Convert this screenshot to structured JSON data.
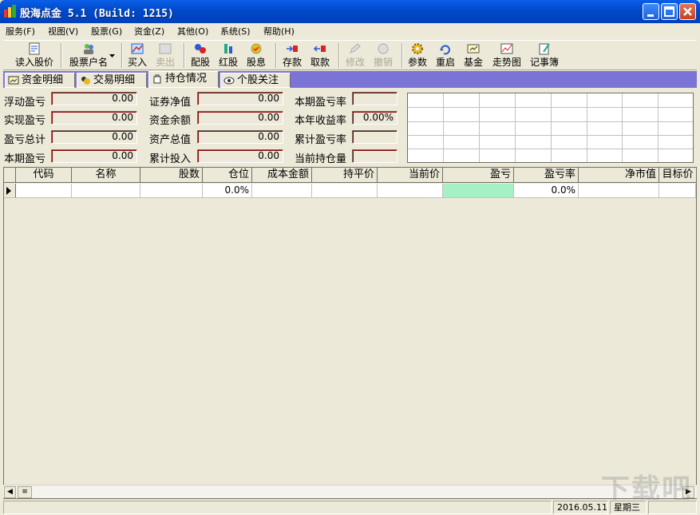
{
  "window": {
    "title": "股海点金 5.1 (Build: 1215)"
  },
  "menu": [
    "服务(F)",
    "视图(V)",
    "股票(G)",
    "资金(Z)",
    "其他(O)",
    "系统(S)",
    "帮助(H)"
  ],
  "toolbar": {
    "read_price": "读入股价",
    "stock_account": "股票户名",
    "buy": "买入",
    "sell": "卖出",
    "allot": "配股",
    "bonus_share": "红股",
    "dividend": "股息",
    "deposit": "存款",
    "withdraw": "取款",
    "modify": "修改",
    "undo": "撤销",
    "params": "参数",
    "restart": "重启",
    "fund": "基金",
    "trend": "走势图",
    "notebook": "记事簿"
  },
  "tabs": [
    "资金明细",
    "交易明细",
    "持仓情况",
    "个股关注"
  ],
  "summary": {
    "floating_pl": {
      "label": "浮动盈亏",
      "value": "0.00"
    },
    "realized_pl": {
      "label": "实现盈亏",
      "value": "0.00"
    },
    "total_pl": {
      "label": "盈亏总计",
      "value": "0.00"
    },
    "period_pl": {
      "label": "本期盈亏",
      "value": "0.00"
    },
    "securities_nav": {
      "label": "证券净值",
      "value": "0.00"
    },
    "cash_balance": {
      "label": "资金余额",
      "value": "0.00"
    },
    "total_assets": {
      "label": "资产总值",
      "value": "0.00"
    },
    "total_invest": {
      "label": "累计投入",
      "value": "0.00"
    },
    "period_pl_rate": {
      "label": "本期盈亏率",
      "value": ""
    },
    "year_return": {
      "label": "本年收益率",
      "value": "0.00%"
    },
    "cum_pl_rate": {
      "label": "累计盈亏率",
      "value": ""
    },
    "current_position": {
      "label": "当前持仓量",
      "value": ""
    }
  },
  "grid": {
    "columns": [
      "代码",
      "名称",
      "股数",
      "仓位",
      "成本金额",
      "持平价",
      "当前价",
      "盈亏",
      "盈亏率",
      "净市值",
      "目标价"
    ],
    "row": {
      "position": "0.0%",
      "pl_rate": "0.0%"
    }
  },
  "status": {
    "date": "2016.05.11",
    "weekday": "星期三"
  },
  "watermark": "下载吧",
  "colors": {
    "title_bar": "#0149c9",
    "tab_bar": "#7b74d6",
    "pl_cell": "#a6f0c6",
    "field_border": "#8b0000"
  }
}
